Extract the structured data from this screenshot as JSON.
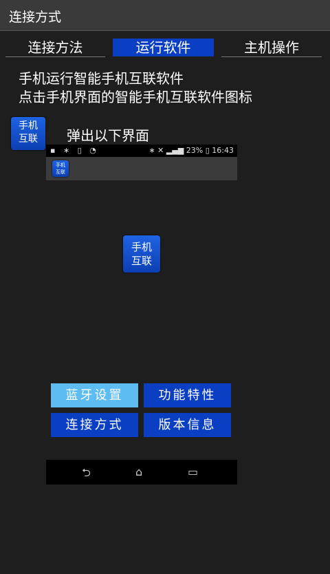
{
  "titlebar": {
    "title": "连接方式"
  },
  "tabs": [
    {
      "label": "连接方法",
      "active": false
    },
    {
      "label": "运行软件",
      "active": true
    },
    {
      "label": "主机操作",
      "active": false
    }
  ],
  "instructions": {
    "line1": "手机运行智能手机互联软件",
    "line2": "点击手机界面的智能手机互联软件图标"
  },
  "app_icon": {
    "line1": "手机",
    "line2": "互联",
    "icon": "phone-link-app-icon"
  },
  "popup_label": "弹出以下界面",
  "phone_screenshot": {
    "status": {
      "battery": "23%",
      "time": "16:43"
    },
    "app_icon": {
      "line1": "手机",
      "line2": "互联"
    }
  },
  "center_icon": {
    "line1": "手机",
    "line2": "互联"
  },
  "menu": {
    "bluetooth": "蓝牙设置",
    "features": "功能特性",
    "connection": "连接方式",
    "version": "版本信息"
  },
  "navbar": {
    "back": "back-icon",
    "home": "home-icon",
    "recent": "recent-apps-icon"
  },
  "colors": {
    "accent": "#0a3fc4",
    "selected": "#5dbdf2",
    "background": "#1e1e1e"
  }
}
